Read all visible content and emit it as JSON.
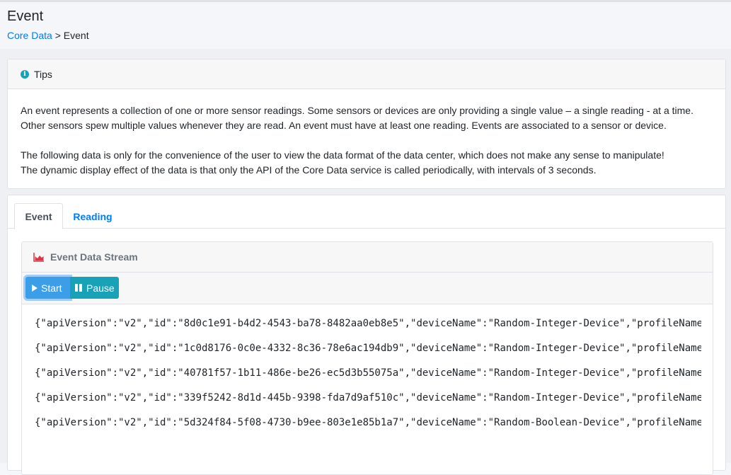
{
  "header": {
    "title": "Event",
    "breadcrumb": {
      "link": "Core Data",
      "separator": " > ",
      "current": "Event"
    }
  },
  "tips": {
    "title": "Tips",
    "paragraph1_line1": "An event represents a collection of one or more sensor readings. Some sensors or devices are only providing a single value – a single reading - at a time.",
    "paragraph1_line2": "Other sensors spew multiple values whenever they are read. An event must have at least one reading. Events are associated to a sensor or device.",
    "paragraph2_line1": "The following data is only for the convenience of the user to view the data format of the data center, which does not make any sense to manipulate!",
    "paragraph2_line2": "The dynamic display effect of the data is that only the API of the Core Data service is called periodically, with intervals of 3 seconds."
  },
  "tabs": [
    {
      "label": "Event",
      "active": true
    },
    {
      "label": "Reading",
      "active": false
    }
  ],
  "stream": {
    "title": "Event Data Stream",
    "start_label": "Start",
    "pause_label": "Pause",
    "lines": [
      "{\"apiVersion\":\"v2\",\"id\":\"8d0c1e91-b4d2-4543-ba78-8482aa0eb8e5\",\"deviceName\":\"Random-Integer-Device\",\"profileName",
      "{\"apiVersion\":\"v2\",\"id\":\"1c0d8176-0c0e-4332-8c36-78e6ac194db9\",\"deviceName\":\"Random-Integer-Device\",\"profileName",
      "{\"apiVersion\":\"v2\",\"id\":\"40781f57-1b11-486e-be26-ec5d3b55075a\",\"deviceName\":\"Random-Integer-Device\",\"profileName",
      "{\"apiVersion\":\"v2\",\"id\":\"339f5242-8d1d-445b-9398-fda7d9af510c\",\"deviceName\":\"Random-Integer-Device\",\"profileName",
      "{\"apiVersion\":\"v2\",\"id\":\"5d324f84-5f08-4730-b9ee-803e1e85b1a7\",\"deviceName\":\"Random-Boolean-Device\",\"profileName"
    ]
  },
  "colors": {
    "link": "#007bff",
    "start_button": "#3d9ee8",
    "pause_button": "#17a2b8",
    "chart_icon": "#dc3545"
  }
}
